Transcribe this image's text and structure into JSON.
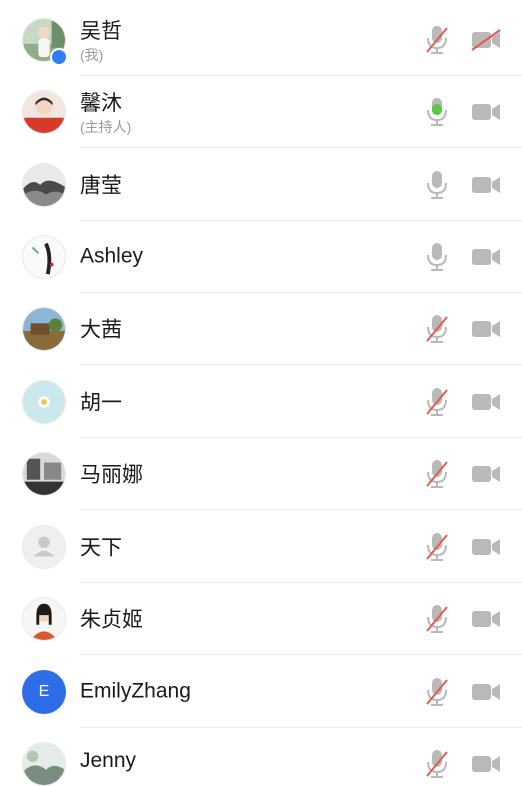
{
  "participants": [
    {
      "name": "吴哲",
      "subtitle": "(我)",
      "mic": "muted",
      "camera": "off",
      "avatar": "photo-person-icon"
    },
    {
      "name": "馨沐",
      "subtitle": "(主持人)",
      "mic": "active",
      "camera": "on",
      "avatar": "photo-person-icon"
    },
    {
      "name": "唐莹",
      "subtitle": "",
      "mic": "on",
      "camera": "on",
      "avatar": "photo-landscape-icon"
    },
    {
      "name": "Ashley",
      "subtitle": "",
      "mic": "on",
      "camera": "on",
      "avatar": "photo-sketch-icon"
    },
    {
      "name": "大茜",
      "subtitle": "",
      "mic": "muted",
      "camera": "on",
      "avatar": "photo-landscape-icon"
    },
    {
      "name": "胡一",
      "subtitle": "",
      "mic": "muted",
      "camera": "on",
      "avatar": "photo-flower-icon"
    },
    {
      "name": "马丽娜",
      "subtitle": "",
      "mic": "muted",
      "camera": "on",
      "avatar": "photo-street-icon"
    },
    {
      "name": "天下",
      "subtitle": "",
      "mic": "muted",
      "camera": "on",
      "avatar": "default-user-icon"
    },
    {
      "name": "朱贞姬",
      "subtitle": "",
      "mic": "muted",
      "camera": "on",
      "avatar": "photo-person-icon"
    },
    {
      "name": "EmilyZhang",
      "subtitle": "",
      "mic": "muted",
      "camera": "on",
      "avatar": "letter-avatar",
      "avatar_letter": "E"
    },
    {
      "name": "Jenny",
      "subtitle": "",
      "mic": "muted",
      "camera": "on",
      "avatar": "photo-landscape-icon"
    }
  ],
  "colors": {
    "icon_gray": "#b9b9b9",
    "muted_slash": "#e85a4f",
    "mic_active": "#5ac840",
    "letter_avatar_bg": "#2f6de8"
  }
}
